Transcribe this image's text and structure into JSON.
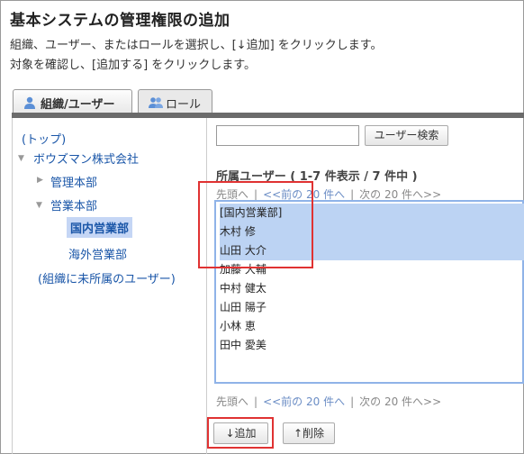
{
  "header": {
    "title": "基本システムの管理権限の追加",
    "description_line1": "組織、ユーザー、またはロールを選択し、[↓追加] をクリックします。",
    "description_line2": "対象を確認し、[追加する] をクリックします。"
  },
  "tabs": [
    {
      "label": "組織/ユーザー",
      "icon": "user-icon",
      "active": true
    },
    {
      "label": "ロール",
      "icon": "users-group-icon",
      "active": false
    }
  ],
  "tree": {
    "top_label": "(トップ)",
    "root_label": "ボウズマン株式会社",
    "child1_label": "管理本部",
    "child2_label": "営業本部",
    "grandchild1_label": "国内営業部",
    "grandchild2_label": "海外営業部",
    "unassigned_label": "(組織に未所属のユーザー)"
  },
  "search": {
    "input_value": "",
    "button_label": "ユーザー検索"
  },
  "users": {
    "heading": "所属ユーザー ( 1-7 件表示 / 7 件中 )",
    "pager": {
      "first": "先頭へ",
      "prev": "<<前の 20 件へ",
      "next": "次の 20 件へ>>"
    },
    "items": [
      {
        "label": "[国内営業部]",
        "selected": true
      },
      {
        "label": "木村 修",
        "selected": true
      },
      {
        "label": "山田 大介",
        "selected": true
      },
      {
        "label": "加藤 大輔",
        "selected": false
      },
      {
        "label": "中村 健太",
        "selected": false
      },
      {
        "label": "山田 陽子",
        "selected": false
      },
      {
        "label": "小林 恵",
        "selected": false
      },
      {
        "label": "田中 愛美",
        "selected": false
      }
    ]
  },
  "actions": {
    "add_label": "↓追加",
    "remove_label": "↑削除"
  },
  "colors": {
    "link": "#1a56a8",
    "selection": "#bcd3f3",
    "highlight_box": "#e03232"
  }
}
